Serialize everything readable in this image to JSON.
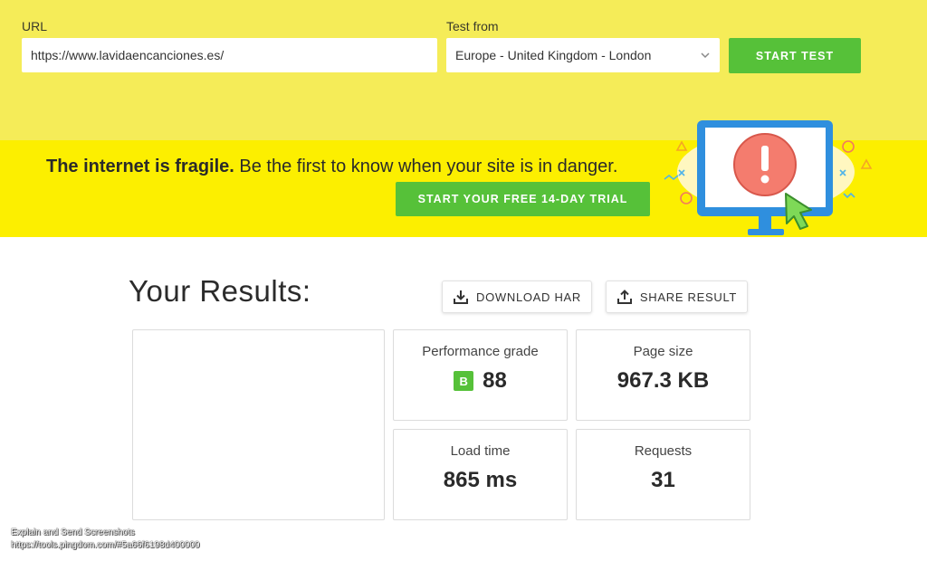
{
  "form": {
    "url_label": "URL",
    "url_value": "https://www.lavidaencanciones.es/",
    "test_from_label": "Test from",
    "test_from_value": "Europe - United Kingdom - London",
    "start_button": "START TEST"
  },
  "promo": {
    "bold_text": "The internet is fragile.",
    "text": " Be the first to know when your site is in danger.",
    "trial_button": "START YOUR FREE 14-DAY TRIAL"
  },
  "results": {
    "title": "Your Results:",
    "download_button": "DOWNLOAD HAR",
    "share_button": "SHARE RESULT",
    "performance_grade": {
      "label": "Performance grade",
      "grade": "B",
      "value": "88"
    },
    "page_size": {
      "label": "Page size",
      "value": "967.3 KB"
    },
    "load_time": {
      "label": "Load time",
      "value": "865 ms"
    },
    "requests": {
      "label": "Requests",
      "value": "31"
    }
  },
  "overlay": {
    "line1": "Explain and Send Screenshots",
    "line2": "https://tools.pingdom.com/#5a66f6198d400000"
  },
  "colors": {
    "top_band": "#f5ec58",
    "promo_band": "#fcef00",
    "accent_green": "#56c139"
  }
}
